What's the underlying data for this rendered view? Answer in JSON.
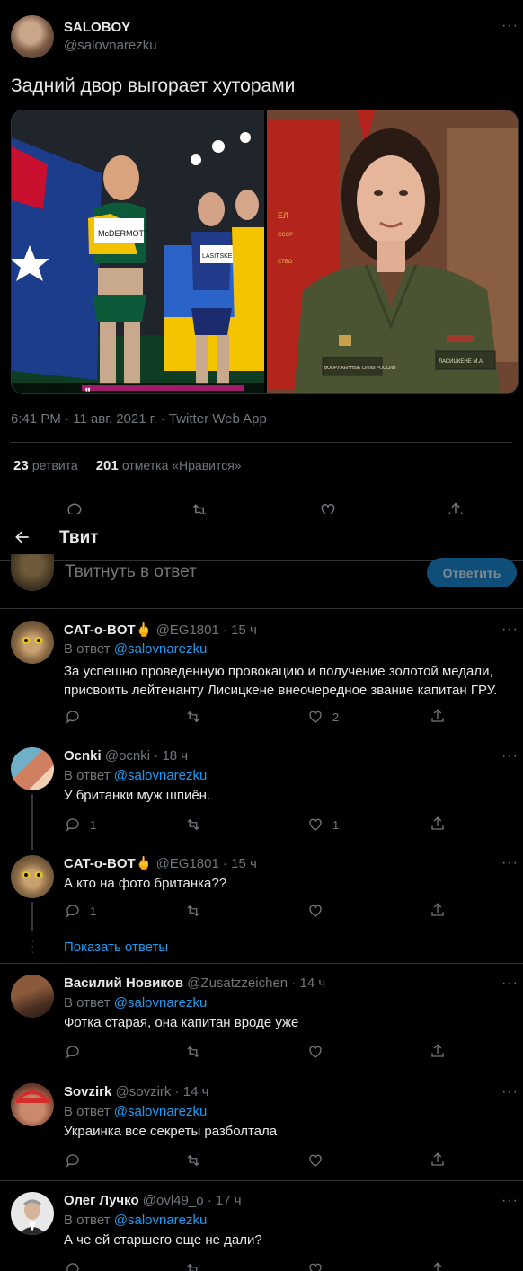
{
  "main_tweet": {
    "author_name": "SALOBOY",
    "author_handle": "@salovnarezku",
    "text": "Задний двор выгорает хуторами",
    "meta": "6:41 PM · 11 авг. 2021 г. · Twitter Web App",
    "retweets_count": "23",
    "retweets_label": "ретвита",
    "likes_count": "201",
    "likes_label": "отметка «Нравится»",
    "left_photo_bib_1": "McDERMOTT",
    "left_photo_bib_2": "LASITSKE",
    "right_photo_patch_1": "ВООРУЖЕННЫЕ СИЛЫ РОССИИ",
    "right_photo_patch_2": "ЛАСИЦКЕНЕ М.А."
  },
  "header": {
    "back_icon": "arrow-left-icon",
    "title": "Твит"
  },
  "composer": {
    "placeholder": "Твитнуть в ответ",
    "button_label": "Ответить"
  },
  "replies": [
    {
      "name": "CAT-о-BOT",
      "emoji": "🖕",
      "handle": "@EG1801",
      "time": "· 15 ч",
      "reply_to_prefix": "В ответ",
      "reply_to": "@salovnarezku",
      "text": "За успешно проведенную провокацию и получение золотой медали, присвоить лейтенанту Лисицкене внеочередное звание капитан ГРУ.",
      "replies": "",
      "retweets": "",
      "likes": "2"
    },
    {
      "name": "Ocnki",
      "handle": "@ocnki",
      "time": "· 18 ч",
      "reply_to_prefix": "В ответ",
      "reply_to": "@salovnarezku",
      "text": "У британки муж шпиён.",
      "replies": "1",
      "retweets": "",
      "likes": "1"
    },
    {
      "name": "CAT-о-BOT",
      "emoji": "🖕",
      "handle": "@EG1801",
      "time": "· 15 ч",
      "text": "А кто на фото британка??",
      "replies": "1",
      "retweets": "",
      "likes": ""
    },
    {
      "name": "Василий Новиков",
      "handle": "@Zusatzzeichen",
      "time": "· 14 ч",
      "reply_to_prefix": "В ответ",
      "reply_to": "@salovnarezku",
      "text": "Фотка старая, она капитан вроде уже"
    },
    {
      "name": "Sovzirk",
      "handle": "@sovzirk",
      "time": "· 14 ч",
      "reply_to_prefix": "В ответ",
      "reply_to": "@salovnarezku",
      "text": "Украинка все секреты разболтала"
    },
    {
      "name": "Олег Лучко",
      "handle": "@ovl49_o",
      "time": "· 17 ч",
      "reply_to_prefix": "В ответ",
      "reply_to": "@salovnarezku",
      "text": "А че ей старшего еще не дали?"
    }
  ],
  "show_replies_label": "Показать ответы",
  "colors": {
    "background": "#000000",
    "text": "#e7e9ea",
    "muted": "#71767b",
    "accent": "#1d9bf0",
    "border": "#2f3336"
  }
}
